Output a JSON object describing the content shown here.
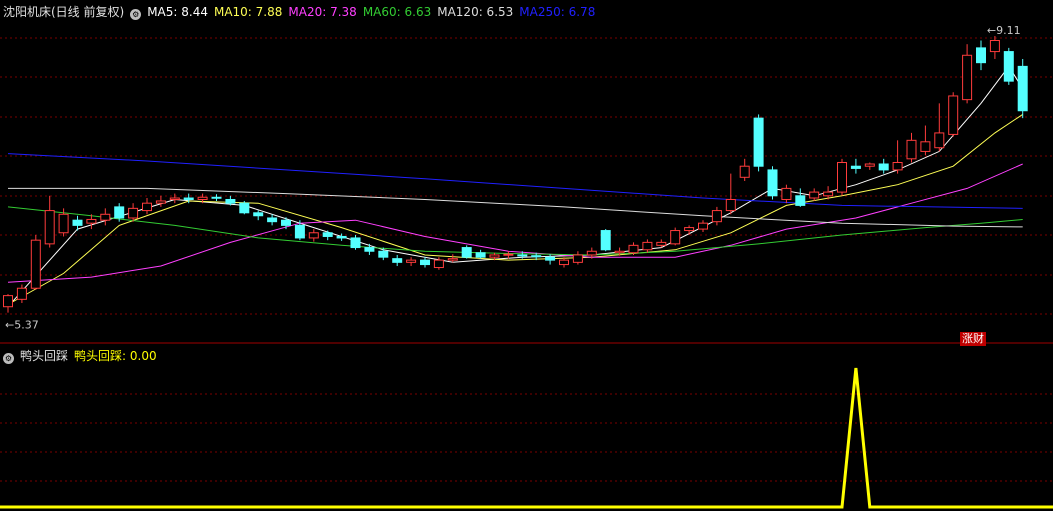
{
  "header": {
    "title": "沈阳机床(日线 前复权)",
    "ma": [
      {
        "label": "MA5: 8.44",
        "color": "#ffffff"
      },
      {
        "label": "MA10: 7.88",
        "color": "#ffff55"
      },
      {
        "label": "MA20: 7.38",
        "color": "#ff40ff"
      },
      {
        "label": "MA60: 6.63",
        "color": "#33cc33"
      },
      {
        "label": "MA120: 6.53",
        "color": "#dddddd"
      },
      {
        "label": "MA250: 6.78",
        "color": "#2020ff"
      }
    ]
  },
  "indicator": {
    "name": "鸭头回踩",
    "value_label": "鸭头回踩: 0.00"
  },
  "badge_label": "涨财",
  "colors": {
    "up": "#ff3c3c",
    "down": "#54ffff",
    "grid": "#7a0000",
    "indicator": "#ffff00"
  },
  "chart_data": {
    "type": "candlestick",
    "price_ylim": [
      5.0,
      9.3
    ],
    "high_marker": "9.11",
    "low_marker": "5.37",
    "candles": [
      [
        5.45,
        5.6,
        5.37,
        5.62
      ],
      [
        5.55,
        5.7,
        5.5,
        5.75
      ],
      [
        5.7,
        6.35,
        5.68,
        6.42
      ],
      [
        6.3,
        6.75,
        6.25,
        6.95
      ],
      [
        6.45,
        6.7,
        6.4,
        6.78
      ],
      [
        6.62,
        6.55,
        6.48,
        6.68
      ],
      [
        6.58,
        6.63,
        6.5,
        6.7
      ],
      [
        6.62,
        6.7,
        6.55,
        6.78
      ],
      [
        6.8,
        6.65,
        6.6,
        6.85
      ],
      [
        6.65,
        6.78,
        6.6,
        6.85
      ],
      [
        6.75,
        6.85,
        6.7,
        6.92
      ],
      [
        6.85,
        6.88,
        6.8,
        6.95
      ],
      [
        6.9,
        6.92,
        6.85,
        6.98
      ],
      [
        6.92,
        6.9,
        6.85,
        6.98
      ],
      [
        6.9,
        6.93,
        6.85,
        6.98
      ],
      [
        6.93,
        6.92,
        6.88,
        6.97
      ],
      [
        6.9,
        6.85,
        6.82,
        6.95
      ],
      [
        6.85,
        6.72,
        6.7,
        6.88
      ],
      [
        6.72,
        6.68,
        6.62,
        6.75
      ],
      [
        6.65,
        6.6,
        6.55,
        6.7
      ],
      [
        6.62,
        6.55,
        6.5,
        6.66
      ],
      [
        6.55,
        6.38,
        6.35,
        6.62
      ],
      [
        6.38,
        6.45,
        6.33,
        6.5
      ],
      [
        6.45,
        6.4,
        6.35,
        6.48
      ],
      [
        6.4,
        6.38,
        6.34,
        6.44
      ],
      [
        6.38,
        6.25,
        6.22,
        6.42
      ],
      [
        6.25,
        6.2,
        6.15,
        6.3
      ],
      [
        6.2,
        6.12,
        6.08,
        6.25
      ],
      [
        6.1,
        6.05,
        6.0,
        6.15
      ],
      [
        6.05,
        6.08,
        6.0,
        6.12
      ],
      [
        6.08,
        6.02,
        5.98,
        6.12
      ],
      [
        5.98,
        6.08,
        5.95,
        6.12
      ],
      [
        6.08,
        6.1,
        6.05,
        6.16
      ],
      [
        6.25,
        6.12,
        6.1,
        6.28
      ],
      [
        6.18,
        6.12,
        6.1,
        6.22
      ],
      [
        6.12,
        6.15,
        6.08,
        6.18
      ],
      [
        6.15,
        6.16,
        6.1,
        6.2
      ],
      [
        6.15,
        6.14,
        6.1,
        6.2
      ],
      [
        6.14,
        6.13,
        6.08,
        6.18
      ],
      [
        6.12,
        6.08,
        6.02,
        6.16
      ],
      [
        6.02,
        6.08,
        5.98,
        6.12
      ],
      [
        6.05,
        6.15,
        6.02,
        6.2
      ],
      [
        6.15,
        6.2,
        6.1,
        6.25
      ],
      [
        6.48,
        6.22,
        6.2,
        6.5
      ],
      [
        6.18,
        6.2,
        6.14,
        6.25
      ],
      [
        6.18,
        6.28,
        6.15,
        6.32
      ],
      [
        6.22,
        6.32,
        6.18,
        6.36
      ],
      [
        6.28,
        6.32,
        6.25,
        6.36
      ],
      [
        6.3,
        6.48,
        6.28,
        6.52
      ],
      [
        6.48,
        6.52,
        6.42,
        6.55
      ],
      [
        6.5,
        6.58,
        6.46,
        6.62
      ],
      [
        6.6,
        6.75,
        6.55,
        6.8
      ],
      [
        6.75,
        6.9,
        6.7,
        7.25
      ],
      [
        7.2,
        7.35,
        7.15,
        7.45
      ],
      [
        8.0,
        7.35,
        7.28,
        8.05
      ],
      [
        7.3,
        6.95,
        6.9,
        7.35
      ],
      [
        6.9,
        7.05,
        6.85,
        7.1
      ],
      [
        6.95,
        6.82,
        6.8,
        7.05
      ],
      [
        6.92,
        7.0,
        6.88,
        7.05
      ],
      [
        6.95,
        7.0,
        6.9,
        7.08
      ],
      [
        7.0,
        7.4,
        6.95,
        7.45
      ],
      [
        7.35,
        7.32,
        7.25,
        7.45
      ],
      [
        7.35,
        7.38,
        7.3,
        7.4
      ],
      [
        7.38,
        7.3,
        7.25,
        7.45
      ],
      [
        7.3,
        7.4,
        7.25,
        7.7
      ],
      [
        7.45,
        7.7,
        7.4,
        7.8
      ],
      [
        7.55,
        7.68,
        7.5,
        7.9
      ],
      [
        7.6,
        7.8,
        7.55,
        8.2
      ],
      [
        7.78,
        8.3,
        7.75,
        8.35
      ],
      [
        8.25,
        8.85,
        8.2,
        9.0
      ],
      [
        8.95,
        8.75,
        8.65,
        9.05
      ],
      [
        8.9,
        9.05,
        8.8,
        9.11
      ],
      [
        8.9,
        8.5,
        8.45,
        8.95
      ],
      [
        8.7,
        8.1,
        8.0,
        8.8
      ]
    ],
    "ma_series": [
      {
        "name": "MA5",
        "color": "#ffffff",
        "points": [
          [
            0,
            5.45
          ],
          [
            5,
            6.5
          ],
          [
            12,
            6.9
          ],
          [
            17,
            6.82
          ],
          [
            22,
            6.52
          ],
          [
            27,
            6.22
          ],
          [
            32,
            6.05
          ],
          [
            37,
            6.12
          ],
          [
            42,
            6.15
          ],
          [
            47,
            6.25
          ],
          [
            52,
            6.72
          ],
          [
            55,
            7.05
          ],
          [
            58,
            6.95
          ],
          [
            61,
            7.1
          ],
          [
            64,
            7.3
          ],
          [
            67,
            7.55
          ],
          [
            70,
            8.2
          ],
          [
            72,
            8.7
          ],
          [
            73,
            8.4
          ]
        ]
      },
      {
        "name": "MA10",
        "color": "#ffff55",
        "points": [
          [
            0,
            5.48
          ],
          [
            4,
            5.9
          ],
          [
            8,
            6.55
          ],
          [
            13,
            6.88
          ],
          [
            18,
            6.85
          ],
          [
            24,
            6.52
          ],
          [
            30,
            6.15
          ],
          [
            36,
            6.08
          ],
          [
            42,
            6.12
          ],
          [
            48,
            6.22
          ],
          [
            52,
            6.45
          ],
          [
            56,
            6.82
          ],
          [
            60,
            6.95
          ],
          [
            64,
            7.1
          ],
          [
            68,
            7.35
          ],
          [
            71,
            7.8
          ],
          [
            73,
            8.05
          ]
        ]
      },
      {
        "name": "MA20",
        "color": "#ff40ff",
        "points": [
          [
            0,
            5.78
          ],
          [
            6,
            5.85
          ],
          [
            11,
            6.0
          ],
          [
            16,
            6.32
          ],
          [
            21,
            6.58
          ],
          [
            25,
            6.62
          ],
          [
            30,
            6.4
          ],
          [
            36,
            6.2
          ],
          [
            42,
            6.12
          ],
          [
            48,
            6.12
          ],
          [
            52,
            6.28
          ],
          [
            56,
            6.5
          ],
          [
            61,
            6.65
          ],
          [
            65,
            6.85
          ],
          [
            69,
            7.05
          ],
          [
            73,
            7.38
          ]
        ]
      },
      {
        "name": "MA60",
        "color": "#33cc33",
        "points": [
          [
            0,
            6.8
          ],
          [
            6,
            6.68
          ],
          [
            12,
            6.55
          ],
          [
            18,
            6.38
          ],
          [
            24,
            6.28
          ],
          [
            30,
            6.2
          ],
          [
            36,
            6.17
          ],
          [
            42,
            6.15
          ],
          [
            48,
            6.2
          ],
          [
            54,
            6.3
          ],
          [
            60,
            6.42
          ],
          [
            66,
            6.52
          ],
          [
            70,
            6.58
          ],
          [
            73,
            6.63
          ]
        ]
      },
      {
        "name": "MA120",
        "color": "#dddddd",
        "points": [
          [
            0,
            7.05
          ],
          [
            10,
            7.05
          ],
          [
            20,
            6.98
          ],
          [
            30,
            6.9
          ],
          [
            40,
            6.8
          ],
          [
            50,
            6.68
          ],
          [
            60,
            6.58
          ],
          [
            68,
            6.54
          ],
          [
            73,
            6.53
          ]
        ]
      },
      {
        "name": "MA250",
        "color": "#2020ff",
        "points": [
          [
            0,
            7.52
          ],
          [
            10,
            7.42
          ],
          [
            20,
            7.3
          ],
          [
            30,
            7.18
          ],
          [
            40,
            7.05
          ],
          [
            50,
            6.92
          ],
          [
            60,
            6.82
          ],
          [
            73,
            6.78
          ]
        ]
      }
    ],
    "indicator_ylim": [
      0,
      1
    ],
    "indicator_values": [
      0,
      0,
      0,
      0,
      0,
      0,
      0,
      0,
      0,
      0,
      0,
      0,
      0,
      0,
      0,
      0,
      0,
      0,
      0,
      0,
      0,
      0,
      0,
      0,
      0,
      0,
      0,
      0,
      0,
      0,
      0,
      0,
      0,
      0,
      0,
      0,
      0,
      0,
      0,
      0,
      0,
      0,
      0,
      0,
      0,
      0,
      0,
      0,
      0,
      0,
      0,
      0,
      0,
      0,
      0,
      0,
      0,
      0,
      0,
      0,
      0,
      1,
      0,
      0,
      0,
      0,
      0,
      0,
      0,
      0,
      0,
      0,
      0,
      0
    ]
  }
}
